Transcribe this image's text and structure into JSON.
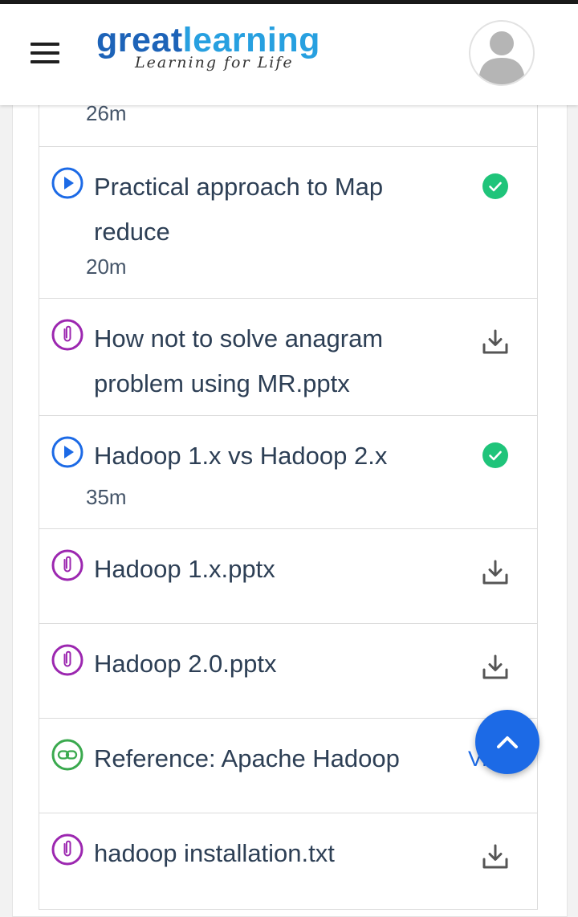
{
  "header": {
    "logo_great": "great",
    "logo_learning": "learning",
    "logo_tagline": "Learning for Life"
  },
  "items": [
    {
      "type": "video",
      "title": "",
      "duration": "26m",
      "status": "completed"
    },
    {
      "type": "video",
      "title": "Practical approach to Map reduce",
      "duration": "20m",
      "status": "completed"
    },
    {
      "type": "attachment",
      "title": "How not to solve anagram problem using MR.pptx",
      "action": "download"
    },
    {
      "type": "video",
      "title": "Hadoop 1.x vs Hadoop 2.x",
      "duration": "35m",
      "status": "completed"
    },
    {
      "type": "attachment",
      "title": "Hadoop 1.x.pptx",
      "action": "download"
    },
    {
      "type": "attachment",
      "title": "Hadoop 2.0.pptx",
      "action": "download"
    },
    {
      "type": "link",
      "title": "Reference: Apache Hadoop",
      "action_label": "Vi"
    },
    {
      "type": "attachment",
      "title": "hadoop installation.txt",
      "action": "download"
    }
  ],
  "colors": {
    "video_icon": "#1c6ae6",
    "attachment_icon": "#9c27b0",
    "link_icon": "#3aa94e",
    "completed": "#1fc47a",
    "fab": "#1c6ae6"
  },
  "icons": {
    "menu": "hamburger-menu-icon",
    "profile": "user-avatar-icon",
    "video": "play-circle-icon",
    "attachment": "paperclip-icon",
    "link": "link-icon",
    "completed": "check-circle-icon",
    "download": "download-icon",
    "scroll_top": "chevron-up-icon"
  }
}
